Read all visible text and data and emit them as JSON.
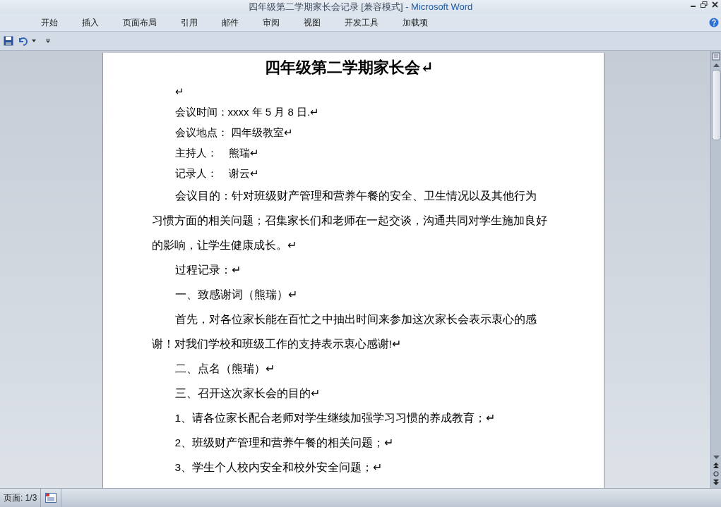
{
  "window": {
    "title": "四年级第二学期家长会记录 [兼容模式]",
    "app": " - Microsoft Word"
  },
  "ribbon_tabs": [
    {
      "label": "开始",
      "selected": false
    },
    {
      "label": "插入",
      "selected": false
    },
    {
      "label": "页面布局",
      "selected": false
    },
    {
      "label": "引用",
      "selected": false
    },
    {
      "label": "邮件",
      "selected": false
    },
    {
      "label": "审阅",
      "selected": false
    },
    {
      "label": "视图",
      "selected": false
    },
    {
      "label": "开发工具",
      "selected": false
    },
    {
      "label": "加载项",
      "selected": false
    }
  ],
  "document": {
    "paragraphs": [
      {
        "kind": "title",
        "text": "四年级第二学期家长会↵"
      },
      {
        "kind": "line",
        "text": "↵"
      },
      {
        "kind": "line",
        "text": "会议时间：xxxx 年 5 月 8 日.↵"
      },
      {
        "kind": "line",
        "text": "会议地点： 四年级教室↵"
      },
      {
        "kind": "line",
        "text": "主持人：    熊瑞↵"
      },
      {
        "kind": "line",
        "text": "记录人：    谢云↵"
      },
      {
        "kind": "para",
        "text": "会议目的：针对班级财产管理和营养午餐的安全、卫生情况以及其他行为习惯方面的相关问题；召集家长们和老师在一起交谈，沟通共同对学生施加良好的影响，让学生健康成长。↵"
      },
      {
        "kind": "para",
        "text": "过程记录：↵"
      },
      {
        "kind": "para",
        "text": "一、致感谢词（熊瑞）↵"
      },
      {
        "kind": "para",
        "text": "首先，对各位家长能在百忙之中抽出时间来参加这次家长会表示衷心的感谢！对我们学校和班级工作的支持表示衷心感谢!↵"
      },
      {
        "kind": "para",
        "text": "二、点名（熊瑞）↵"
      },
      {
        "kind": "para",
        "text": "三、召开这次家长会的目的↵"
      },
      {
        "kind": "para",
        "text": "1、请各位家长配合老师对学生继续加强学习习惯的养成教育；↵"
      },
      {
        "kind": "para",
        "text": "2、班级财产管理和营养午餐的相关问题；↵"
      },
      {
        "kind": "para",
        "text": "3、学生个人校内安全和校外安全问题；↵"
      }
    ]
  },
  "status_bar": {
    "page": "页面: 1/3"
  }
}
